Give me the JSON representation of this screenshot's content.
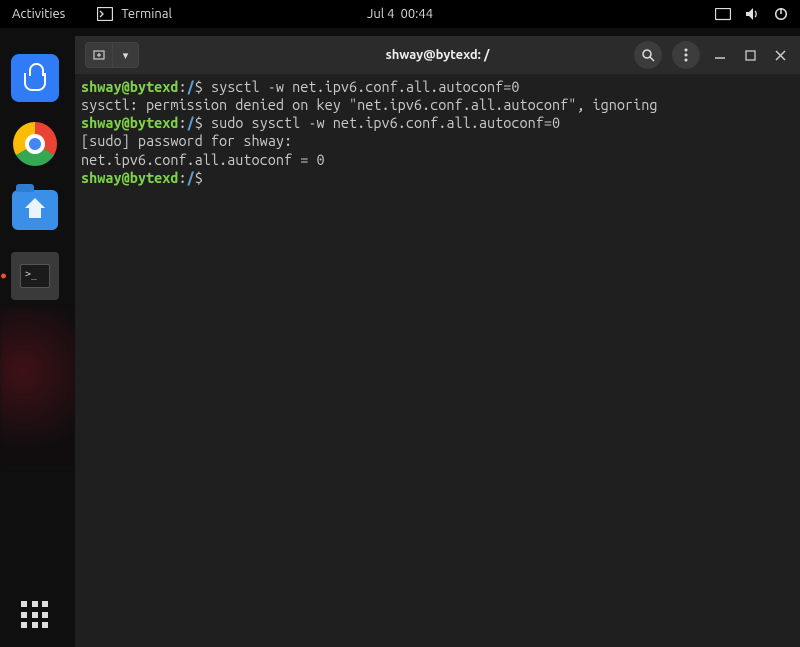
{
  "topbar": {
    "activities": "Activities",
    "appname": "Terminal",
    "date": "Jul 4",
    "time": "00:44"
  },
  "dock": {
    "items": [
      {
        "name": "software-store"
      },
      {
        "name": "google-chrome"
      },
      {
        "name": "files"
      },
      {
        "name": "terminal"
      }
    ]
  },
  "window": {
    "title": "shway@bytexd: /"
  },
  "prompt": {
    "userhost": "shway@bytexd",
    "path": "/",
    "symbol": "$"
  },
  "lines": {
    "cmd1": " sysctl -w net.ipv6.conf.all.autoconf=0",
    "out1": "sysctl: permission denied on key \"net.ipv6.conf.all.autoconf\", ignoring",
    "cmd2": " sudo sysctl -w net.ipv6.conf.all.autoconf=0",
    "out2": "[sudo] password for shway:",
    "out3": "net.ipv6.conf.all.autoconf = 0"
  }
}
